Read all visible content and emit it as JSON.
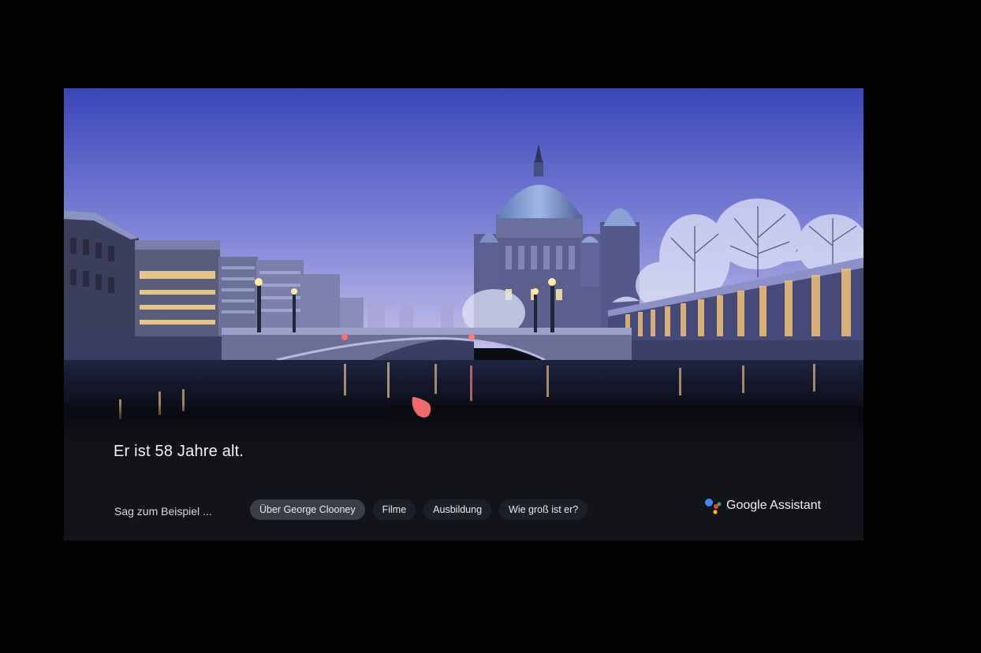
{
  "assistant": {
    "response_text": "Er ist 58 Jahre alt.",
    "suggestion_prompt": "Sag zum Beispiel ...",
    "suggestions": [
      {
        "label": "Über George Clooney",
        "active": true
      },
      {
        "label": "Filme",
        "active": false
      },
      {
        "label": "Ausbildung",
        "active": false
      },
      {
        "label": "Wie groß ist er?",
        "active": false
      }
    ],
    "brand_label": "Google Assistant"
  },
  "colors": {
    "ga_blue": "#4285F4",
    "ga_red": "#EA4335",
    "ga_yellow": "#FBBC05",
    "ga_green": "#34A853",
    "listening_indicator": "#ef6a6a",
    "sky_top": "#3a46b8",
    "sky_bottom": "#b9b6e4"
  },
  "icons": {
    "brand": "google-assistant-dots-icon",
    "listening": "assistant-listening-indicator-icon"
  },
  "background": {
    "scene": "wallpaper-photo-river-bridge-cathedral-dusk"
  }
}
